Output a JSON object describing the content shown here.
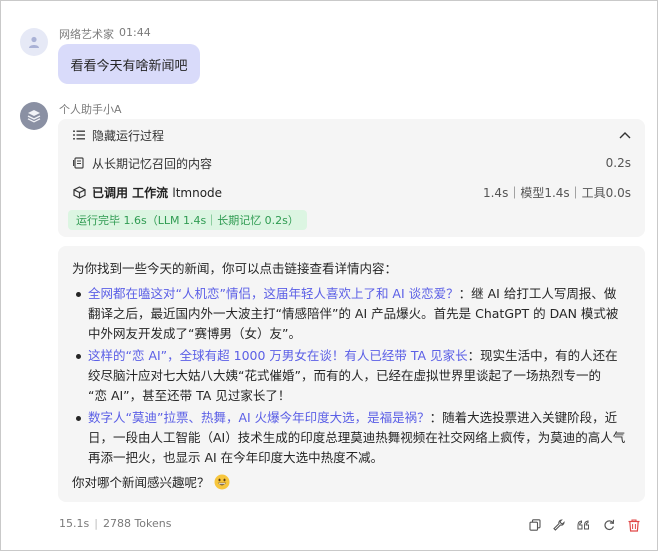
{
  "user": {
    "name": "网络艺术家",
    "time": "01:44",
    "message": "看看今天有啥新闻吧"
  },
  "bot": {
    "name": "个人助手小A",
    "process": {
      "toggle_label": "隐藏运行过程",
      "memory_label": "从长期记忆召回的内容",
      "memory_time": "0.2s",
      "workflow_prefix": "已调用 工作流",
      "workflow_name": "ltmnode",
      "workflow_time": "1.4s｜模型1.4s｜工具0.0s",
      "status": "运行完毕 1.6s（LLM 1.4s｜长期记忆 0.2s）"
    },
    "answer": {
      "intro": "为你找到一些今天的新闻，你可以点击链接查看详情内容：",
      "items": [
        {
          "link": "全网都在嗑这对“人机恋”情侣，这届年轻人喜欢上了和 AI 谈恋爱？",
          "line1_rest": "：继 AI 给打工人写周报、做",
          "line2": "翻译之后，最近国内外一大波主打“情感陪伴”的 AI 产品爆火。首先是 ChatGPT 的 DAN 模式被",
          "line3": "中外网友开发成了“赛博男（女）友”。"
        },
        {
          "link": "这样的“恋 AI”，全球有超 1000 万男女在谈！有人已经带 TA 见家长",
          "line1_rest": "：现实生活中，有的人还在",
          "line2": "绞尽脑汁应对七大姑八大姨“花式催婚”，而有的人，已经在虚拟世界里谈起了一场热烈专一的",
          "line3": "“恋 AI”，甚至还带 TA 见过家长了！"
        },
        {
          "link": "数字人“莫迪”拉票、热舞，AI 火爆今年印度大选，是福是祸？",
          "line1_rest": "：随着大选投票进入关键阶段，近",
          "line2": "日，一段由人工智能（AI）技术生成的印度总理莫迪热舞视频在社交网络上疯传，为莫迪的高人气",
          "line3": "再添一把火，也显示 AI 在今年印度大选中热度不减。"
        }
      ],
      "outro": "你对哪个新闻感兴趣呢？"
    },
    "footer": {
      "duration": "15.1s",
      "tokens": "2788 Tokens"
    }
  },
  "icons": {
    "user_avatar": "person-icon",
    "bot_avatar": "layers-icon",
    "toggle": "list-icon",
    "collapse": "chevron-up-icon",
    "memory": "memory-icon",
    "workflow": "cube-icon",
    "emoji": "grinning-face-emoji",
    "copy": "copy-icon",
    "tool": "wrench-icon",
    "quote": "quote-icon",
    "refresh": "refresh-icon",
    "delete": "trash-icon"
  },
  "colors": {
    "link": "#5b5fe6",
    "status_bg": "#dcf5e2",
    "status_text": "#2f9b52",
    "user_bubble": "#d9dbfa",
    "delete": "#e04848"
  }
}
